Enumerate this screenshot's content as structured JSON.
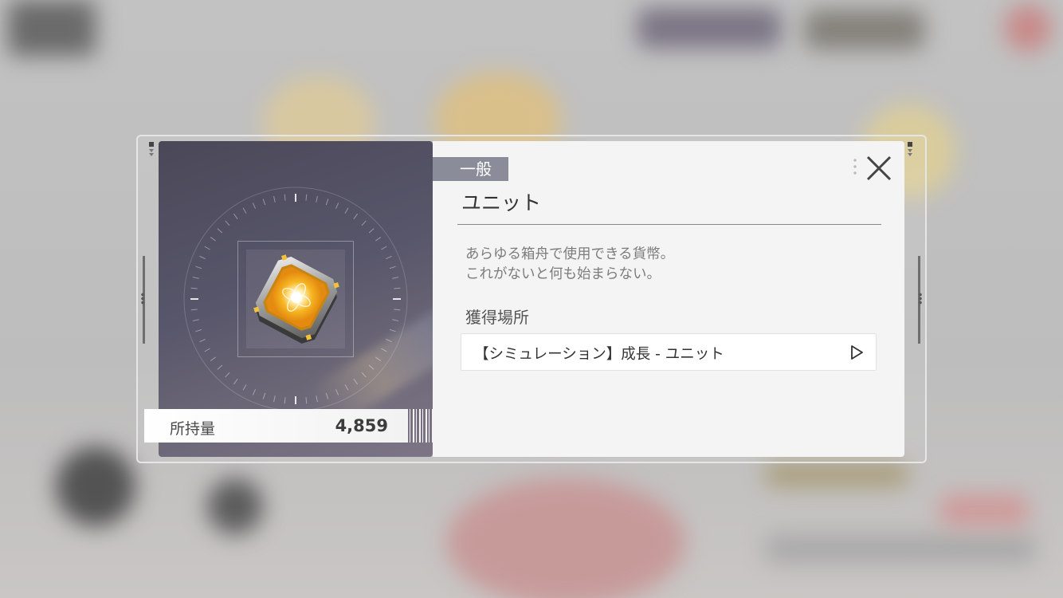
{
  "item": {
    "category": "一般",
    "name": "ユニット",
    "description": "あらゆる箱舟で使用できる貨幣。\nこれがないと何も始まらない。",
    "owned_label": "所持量",
    "owned_value": "4,859",
    "icon": "gold-crystal-currency-icon"
  },
  "acquisition": {
    "title": "獲得場所",
    "sources": [
      {
        "label": "【シミュレーション】成長 - ユニット",
        "icon": "play-triangle-icon"
      }
    ]
  },
  "colors": {
    "panel_bg": "#f4f4f4",
    "tag_bg": "#8a8d99",
    "crystal_gold": "#f5b21b"
  }
}
